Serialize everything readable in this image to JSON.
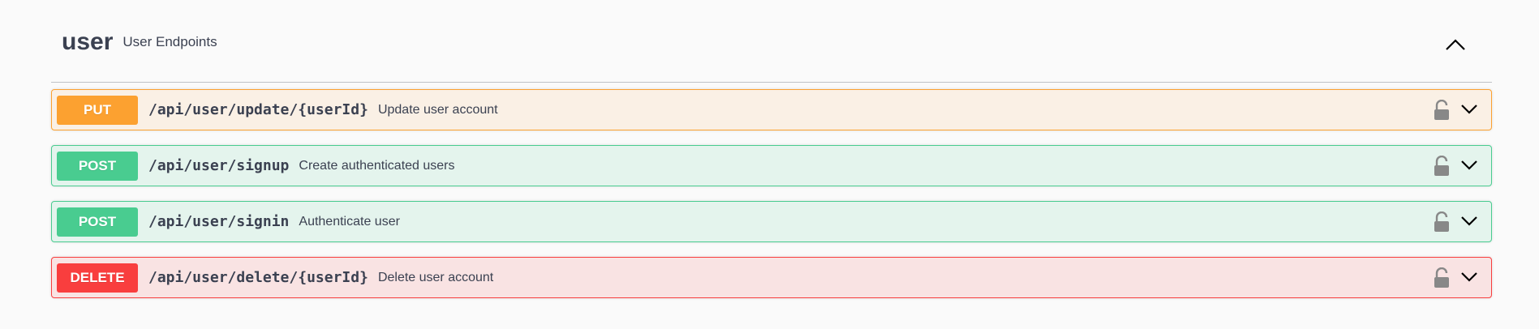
{
  "tag": {
    "name": "user",
    "description": "User Endpoints"
  },
  "operations": [
    {
      "method": "PUT",
      "path": "/api/user/update/{userId}",
      "summary": "Update user account"
    },
    {
      "method": "POST",
      "path": "/api/user/signup",
      "summary": "Create authenticated users"
    },
    {
      "method": "POST",
      "path": "/api/user/signin",
      "summary": "Authenticate user"
    },
    {
      "method": "DELETE",
      "path": "/api/user/delete/{userId}",
      "summary": "Delete user account"
    }
  ],
  "icons": {
    "collapse": "chevron-up-icon",
    "lock": "unlocked-padlock-icon",
    "expand": "chevron-down-icon"
  },
  "colors": {
    "put": "#fca130",
    "post": "#49cc90",
    "delete": "#f93e3e",
    "text": "#3b4151"
  }
}
